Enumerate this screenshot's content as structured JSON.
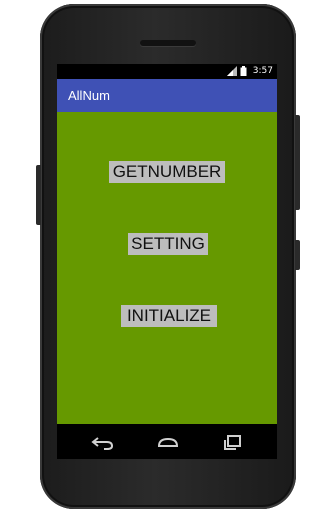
{
  "status_bar": {
    "time": "3:57",
    "icons": [
      "signal-icon",
      "battery-icon"
    ]
  },
  "app_bar": {
    "title": "AllNum",
    "color": "#3f51b5"
  },
  "content": {
    "background": "#669900",
    "buttons": [
      {
        "label": "GETNUMBER"
      },
      {
        "label": "SETTING"
      },
      {
        "label": "INITIALIZE"
      }
    ]
  },
  "nav_bar": {
    "icons": [
      "back-icon",
      "home-icon",
      "recents-icon"
    ]
  }
}
